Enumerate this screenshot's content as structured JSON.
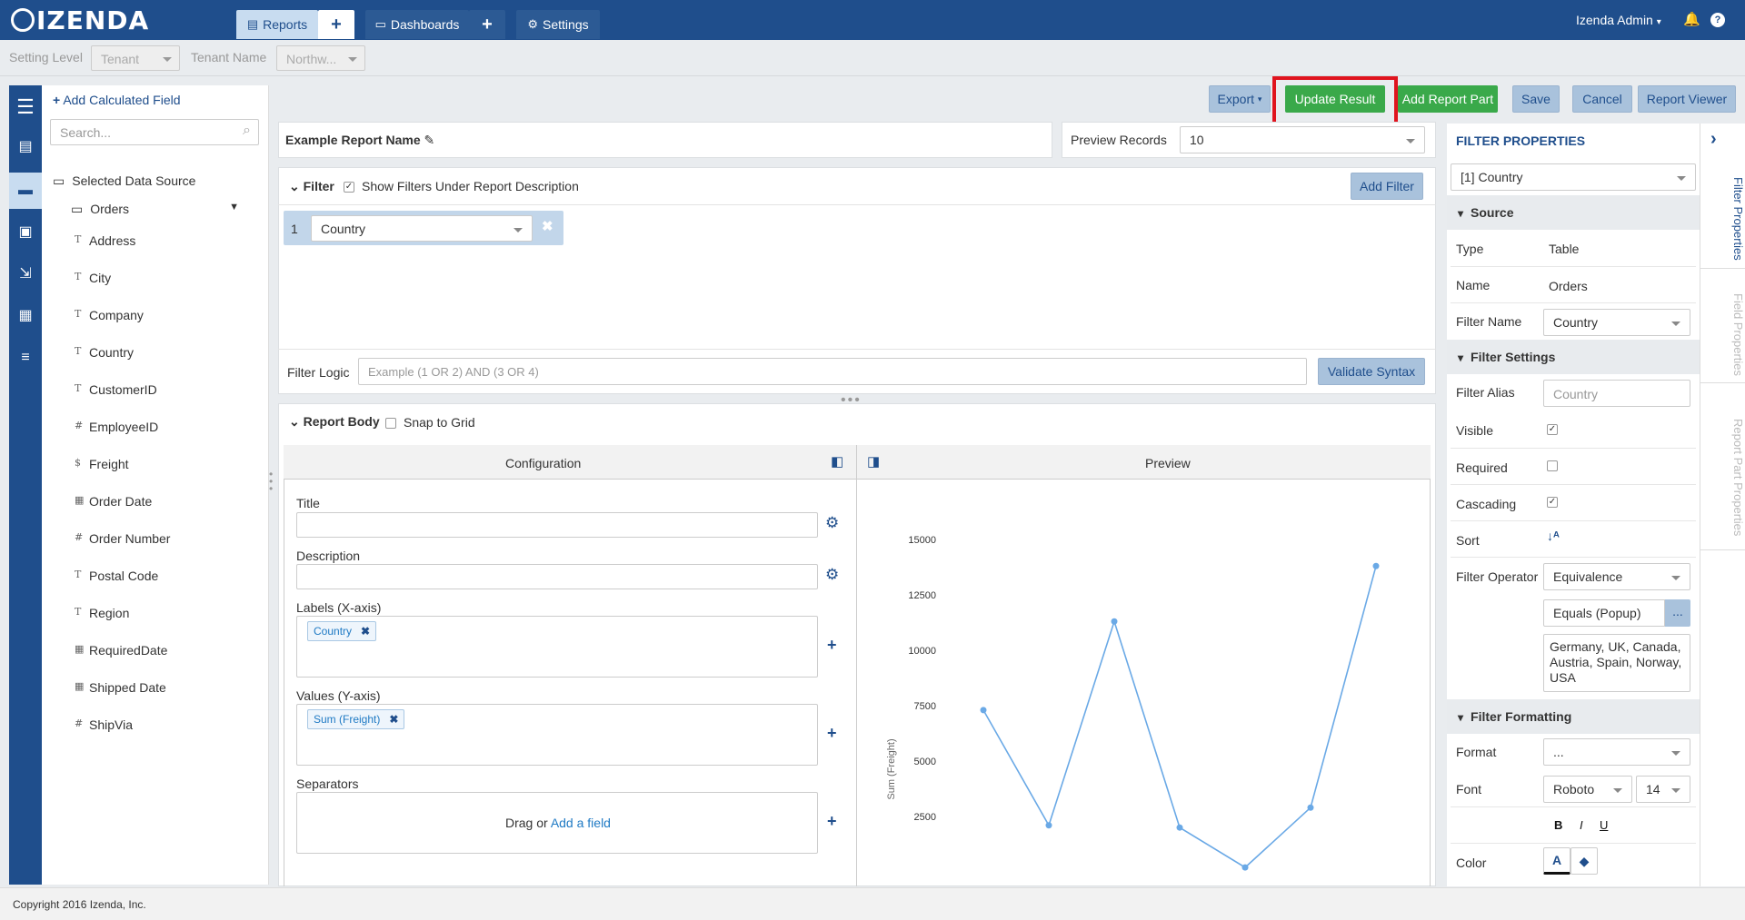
{
  "app": {
    "brand": "IZENDA",
    "copyright": "Copyright 2016 Izenda, Inc."
  },
  "nav": {
    "reports": "Reports",
    "dashboards": "Dashboards",
    "settings": "Settings",
    "plus": "+",
    "user": "Izenda Admin"
  },
  "subbar": {
    "setting_level_label": "Setting Level",
    "setting_level_value": "Tenant",
    "tenant_label": "Tenant Name",
    "tenant_value": "Northw..."
  },
  "fields_panel": {
    "add_calc": "Add Calculated Field",
    "search_placeholder": "Search...",
    "data_source": "Selected Data Source",
    "table": "Orders",
    "fields": [
      {
        "icon": "T",
        "name": "Address"
      },
      {
        "icon": "T",
        "name": "City"
      },
      {
        "icon": "T",
        "name": "Company"
      },
      {
        "icon": "T",
        "name": "Country"
      },
      {
        "icon": "T",
        "name": "CustomerID"
      },
      {
        "icon": "#",
        "name": "EmployeeID"
      },
      {
        "icon": "$",
        "name": "Freight"
      },
      {
        "icon": "▦",
        "name": "Order Date"
      },
      {
        "icon": "#",
        "name": "Order Number"
      },
      {
        "icon": "T",
        "name": "Postal Code"
      },
      {
        "icon": "T",
        "name": "Region"
      },
      {
        "icon": "▦",
        "name": "RequiredDate"
      },
      {
        "icon": "▦",
        "name": "Shipped Date"
      },
      {
        "icon": "#",
        "name": "ShipVia"
      }
    ]
  },
  "toolbar": {
    "export": "Export",
    "update": "Update Result",
    "add_part": "Add Report Part",
    "save": "Save",
    "cancel": "Cancel",
    "viewer": "Report Viewer"
  },
  "report": {
    "name": "Example Report Name",
    "preview_label": "Preview Records",
    "preview_value": "10"
  },
  "filter": {
    "title": "Filter",
    "show_label": "Show Filters Under Report Description",
    "add": "Add Filter",
    "item_index": "1",
    "item_field": "Country",
    "logic_label": "Filter Logic",
    "logic_placeholder": "Example (1 OR 2) AND (3 OR 4)",
    "validate": "Validate Syntax"
  },
  "body": {
    "title": "Report Body",
    "snap": "Snap to Grid",
    "config": "Configuration",
    "preview": "Preview",
    "title_label": "Title",
    "desc_label": "Description",
    "labels_label": "Labels (X-axis)",
    "labels_tag": "Country",
    "values_label": "Values (Y-axis)",
    "values_tag": "Sum (Freight)",
    "sep_label": "Separators",
    "drag_text": "Drag or",
    "add_field": "Add a field"
  },
  "chart_data": {
    "type": "line",
    "ylabel": "Sum (Freight)",
    "yticks": [
      "15000",
      "12500",
      "10000",
      "7500",
      "5000",
      "2500"
    ],
    "ylim": [
      0,
      15000
    ],
    "series": [
      {
        "values": [
          7300,
          2100,
          11300,
          2000,
          200,
          2900,
          13800
        ]
      }
    ]
  },
  "props": {
    "header": "FILTER PROPERTIES",
    "selected": "[1] Country",
    "source": "Source",
    "type_label": "Type",
    "type_value": "Table",
    "name_label": "Name",
    "name_value": "Orders",
    "fname_label": "Filter Name",
    "fname_value": "Country",
    "settings": "Filter Settings",
    "alias_label": "Filter Alias",
    "alias_value": "Country",
    "visible": "Visible",
    "required": "Required",
    "cascading": "Cascading",
    "sort": "Sort",
    "op_label": "Filter Operator",
    "op_value": "Equivalence",
    "op_sub": "Equals (Popup)",
    "ellipsis": "...",
    "values": "Germany, UK, Canada, Austria, Spain, Norway, USA",
    "formatting": "Filter Formatting",
    "format_label": "Format",
    "format_value": "...",
    "font_label": "Font",
    "font_value": "Roboto",
    "font_size": "14",
    "color_label": "Color",
    "vtabs": [
      "Filter Properties",
      "Field Properties",
      "Report Part Properties"
    ]
  }
}
